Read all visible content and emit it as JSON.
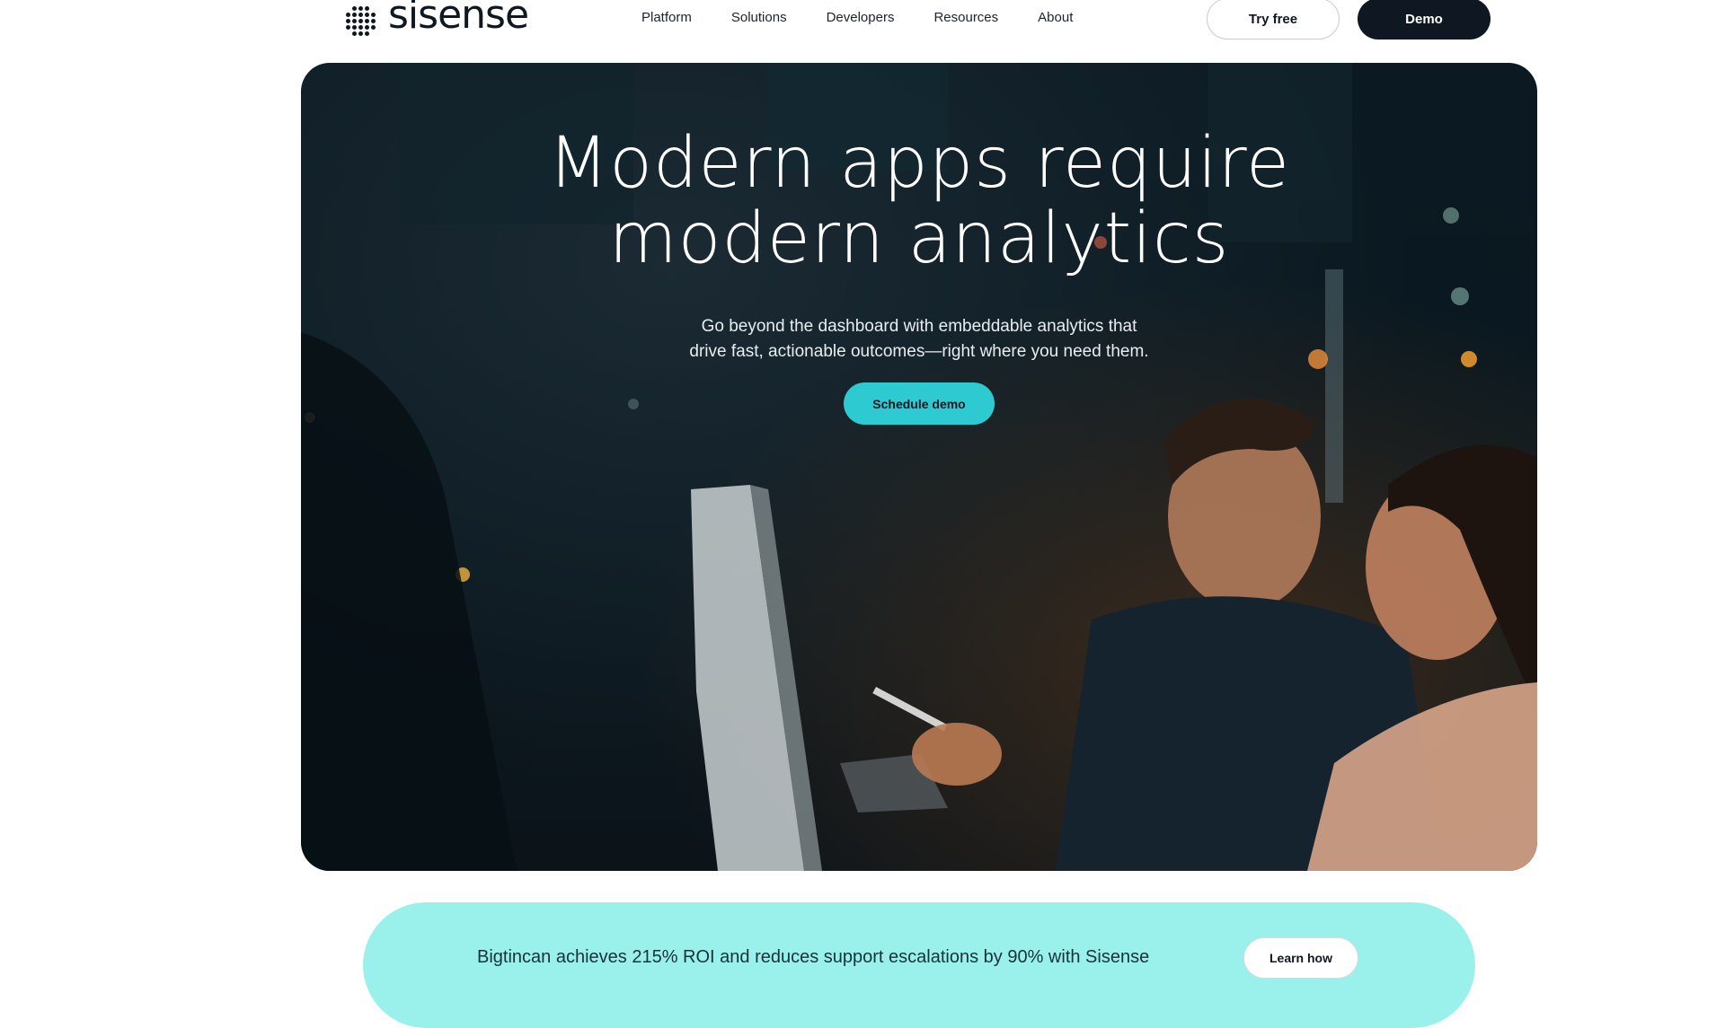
{
  "header": {
    "logo_text": "sisense",
    "logo_icon": "dot-grid-logo-icon",
    "nav": [
      {
        "label": "Platform"
      },
      {
        "label": "Solutions"
      },
      {
        "label": "Developers"
      },
      {
        "label": "Resources"
      },
      {
        "label": "About"
      }
    ],
    "try_free_label": "Try free",
    "demo_label": "Demo"
  },
  "hero": {
    "title_line1": "Modern apps require",
    "title_line2": "modern analytics",
    "subtitle_line1": "Go beyond the dashboard with embeddable analytics that",
    "subtitle_line2": "drive fast, actionable outcomes—right where you need them.",
    "cta_label": "Schedule demo",
    "image": "two people working at a computer at night in an office"
  },
  "banner": {
    "text": "Bigtincan achieves 215% ROI and reduces support escalations by 90% with Sisense",
    "cta_label": "Learn how"
  },
  "colors": {
    "brand_dark": "#0f1822",
    "accent_teal": "#2ecad1",
    "banner_bg": "#9af1ec"
  }
}
